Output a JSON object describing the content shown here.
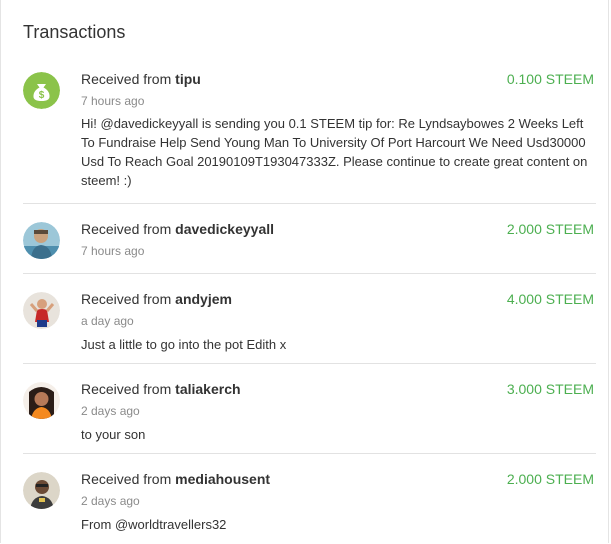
{
  "panel": {
    "title": "Transactions"
  },
  "transactions": [
    {
      "prefix": "Received from ",
      "user": "tipu",
      "amount": "0.100 STEEM",
      "time": "7 hours ago",
      "memo": "Hi! @davedickeyyall is sending you 0.1 STEEM tip for: Re Lyndsaybowes 2 Weeks Left To Fundraise Help Send Young Man To University Of Port Harcourt We Need Usd30000 Usd To Reach Goal 20190109T193047333Z. Please continue to create great content on steem! :)",
      "avatar_icon": "money-bag-icon"
    },
    {
      "prefix": "Received from ",
      "user": "davedickeyyall",
      "amount": "2.000 STEEM",
      "time": "7 hours ago",
      "memo": "",
      "avatar_icon": "user-avatar"
    },
    {
      "prefix": "Received from ",
      "user": "andyjem",
      "amount": "4.000 STEEM",
      "time": "a day ago",
      "memo": "Just a little to go into the pot Edith x",
      "avatar_icon": "user-avatar"
    },
    {
      "prefix": "Received from ",
      "user": "taliakerch",
      "amount": "3.000 STEEM",
      "time": "2 days ago",
      "memo": "to your son",
      "avatar_icon": "user-avatar"
    },
    {
      "prefix": "Received from ",
      "user": "mediahousent",
      "amount": "2.000 STEEM",
      "time": "2 days ago",
      "memo": "From @worldtravellers32",
      "avatar_icon": "user-avatar"
    }
  ],
  "colors": {
    "amount": "#4caf50",
    "tip_badge": "#8bc34a"
  }
}
